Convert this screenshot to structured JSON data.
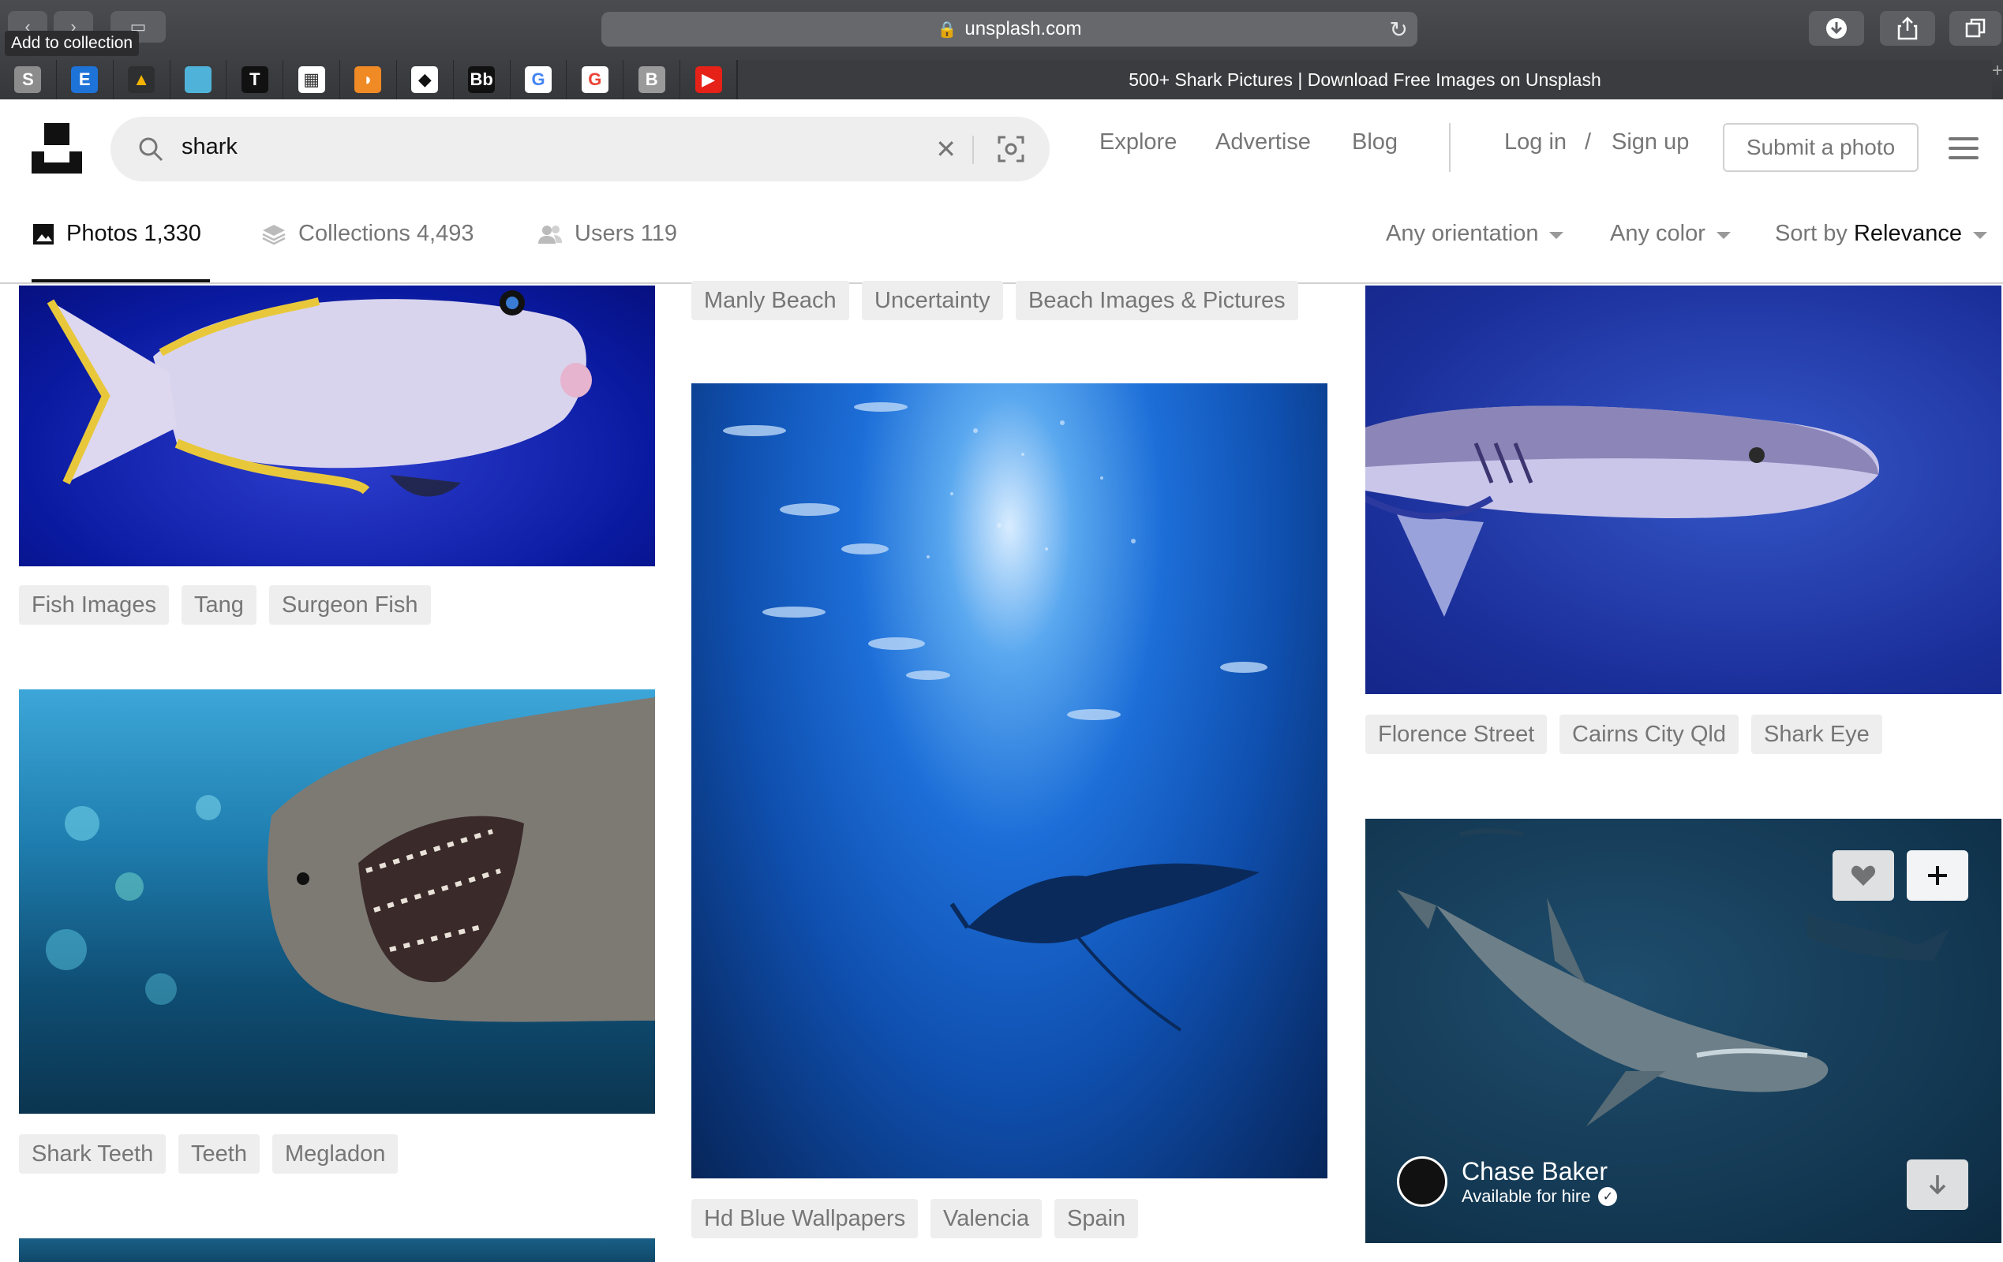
{
  "browser": {
    "tooltip": "Add to collection",
    "url": "unsplash.com",
    "tab_title": "500+ Shark Pictures | Download Free Images on Unsplash",
    "bookmarks": [
      {
        "label": "S",
        "color": "#8c8c8c",
        "fg": "#ffffff"
      },
      {
        "label": "E",
        "color": "#1e73d8",
        "fg": "#ffffff"
      },
      {
        "label": "▲",
        "color": "#2e2f31",
        "fg": "#f4b400"
      },
      {
        "label": "",
        "color": "#4fb3d9",
        "fg": "#ffffff"
      },
      {
        "label": "T",
        "color": "#111111",
        "fg": "#ffffff"
      },
      {
        "label": "▦",
        "color": "#ffffff",
        "fg": "#333333"
      },
      {
        "label": "◗",
        "color": "#f08a24",
        "fg": "#ffffff"
      },
      {
        "label": "◆",
        "color": "#ffffff",
        "fg": "#111111"
      },
      {
        "label": "Bb",
        "color": "#111111",
        "fg": "#ffffff"
      },
      {
        "label": "G",
        "color": "#ffffff",
        "fg": "#4285f4"
      },
      {
        "label": "G",
        "color": "#ffffff",
        "fg": "#ea4335"
      },
      {
        "label": "B",
        "color": "#9a9a9a",
        "fg": "#ffffff"
      },
      {
        "label": "▶",
        "color": "#e62117",
        "fg": "#ffffff"
      }
    ]
  },
  "header": {
    "search_value": "shark",
    "nav": [
      "Explore",
      "Advertise",
      "Blog"
    ],
    "login": "Log in",
    "slash": "/",
    "signup": "Sign up",
    "submit": "Submit a photo"
  },
  "tabs": [
    {
      "label": "Photos 1,330",
      "icon": "image-icon"
    },
    {
      "label": "Collections 4,493",
      "icon": "collections-icon"
    },
    {
      "label": "Users 119",
      "icon": "users-icon"
    }
  ],
  "filters": {
    "orientation": "Any orientation",
    "color": "Any color",
    "sort_prefix": "Sort by",
    "sort_value": "Relevance"
  },
  "photos": [
    {
      "subject": "surgeonfish",
      "tags": [
        "Fish Images",
        "Tang",
        "Surgeon Fish"
      ]
    },
    {
      "subject": "shark-teeth",
      "tags": [
        "Shark Teeth",
        "Teeth",
        "Megladon"
      ]
    },
    {
      "subject": "previous-photo",
      "tags": [
        "Manly Beach",
        "Uncertainty",
        "Beach Images & Pictures"
      ]
    },
    {
      "subject": "manta-ray",
      "tags": [
        "Hd Blue Wallpapers",
        "Valencia",
        "Spain"
      ]
    },
    {
      "subject": "shark-side",
      "tags": [
        "Florence Street",
        "Cairns City Qld",
        "Shark Eye"
      ]
    },
    {
      "subject": "reef-shark",
      "tags": [],
      "author": "Chase Baker",
      "author_sub": "Available for hire"
    }
  ]
}
